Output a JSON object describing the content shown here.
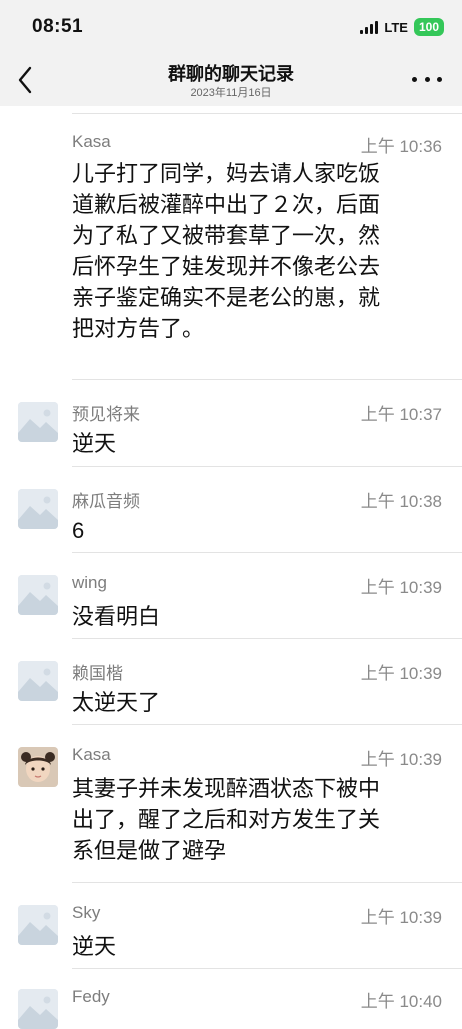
{
  "status": {
    "time": "08:51",
    "network": "LTE",
    "battery": "100"
  },
  "nav": {
    "title": "群聊的聊天记录",
    "subtitle": "2023年11月16日"
  },
  "messages": [
    {
      "sender": "Kasa",
      "time": "上午 10:36",
      "lines": [
        "儿子打了同学，妈去请人家吃饭",
        "道歉后被灌醉中出了２次，后面",
        "为了私了又被带套草了一次，然",
        "后怀孕生了娃发现并不像老公去",
        "亲子鉴定确实不是老公的崽，就",
        "把对方告了。"
      ]
    },
    {
      "sender": "预见将来",
      "time": "上午 10:37",
      "lines": [
        "逆天"
      ]
    },
    {
      "sender": "麻瓜音频",
      "time": "上午 10:38",
      "lines": [
        "6"
      ]
    },
    {
      "sender": "wing",
      "time": "上午 10:39",
      "lines": [
        "没看明白"
      ]
    },
    {
      "sender": "赖国楷",
      "time": "上午 10:39",
      "lines": [
        "太逆天了"
      ]
    },
    {
      "sender": "Kasa",
      "time": "上午 10:39",
      "lines": [
        "其妻子并未发现醉酒状态下被中",
        "出了，醒了之后和对方发生了关",
        "系但是做了避孕"
      ]
    },
    {
      "sender": "Sky",
      "time": "上午 10:39",
      "lines": [
        "逆天"
      ]
    },
    {
      "sender": "Fedy",
      "time": "上午 10:40",
      "lines": []
    }
  ]
}
